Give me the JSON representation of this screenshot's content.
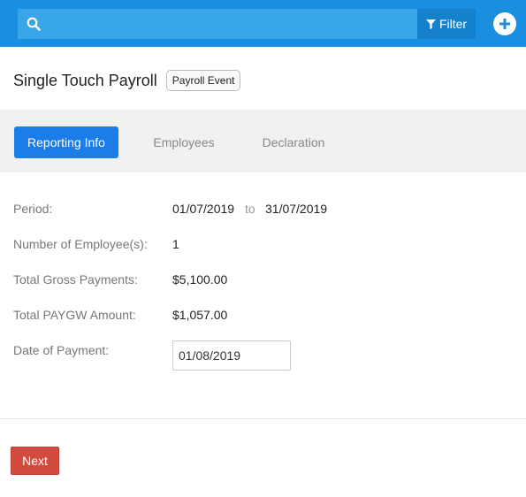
{
  "header": {
    "search_placeholder": "",
    "filter_label": "Filter",
    "search_icon": "search-icon",
    "filter_icon": "filter-icon",
    "add_icon": "plus-circle-icon",
    "bar_color": "#1a8fe0"
  },
  "page": {
    "title": "Single Touch Payroll",
    "badge": "Payroll Event"
  },
  "tabs": [
    {
      "label": "Reporting Info",
      "active": true
    },
    {
      "label": "Employees",
      "active": false
    },
    {
      "label": "Declaration",
      "active": false
    }
  ],
  "fields": {
    "period_label": "Period:",
    "period_from": "01/07/2019",
    "period_to_word": "to",
    "period_to": "31/07/2019",
    "employees_label": "Number of Employee(s):",
    "employees_value": "1",
    "gross_label": "Total Gross Payments:",
    "gross_value": "$5,100.00",
    "paygw_label": "Total PAYGW Amount:",
    "paygw_value": "$1,057.00",
    "payment_date_label": "Date of Payment:",
    "payment_date_value": "01/08/2019"
  },
  "footer": {
    "next_label": "Next",
    "next_color": "#d24b3f"
  }
}
